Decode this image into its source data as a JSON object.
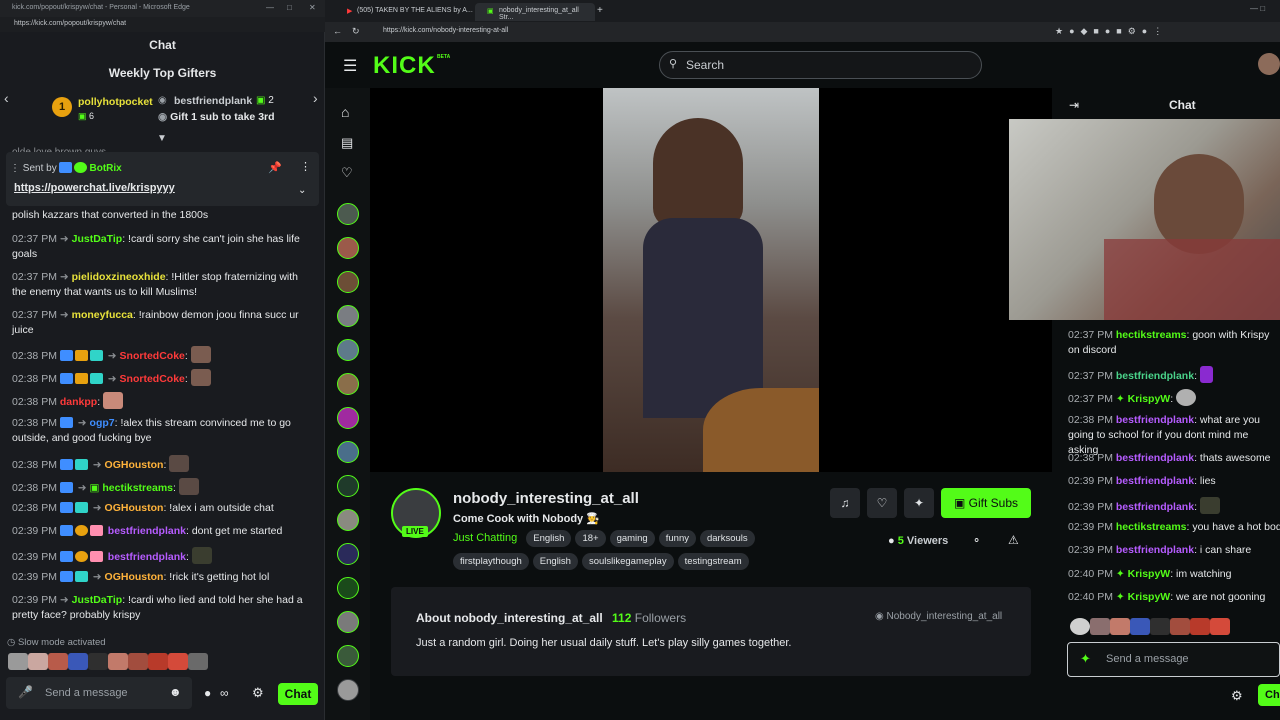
{
  "left_window": {
    "title": "kick.com/popout/krispyw/chat - Personal - Microsoft Edge",
    "url": "https://kick.com/popout/krispyw/chat",
    "chat_heading": "Chat",
    "gifters_title": "Weekly Top Gifters",
    "gifter1": {
      "rank": "1",
      "name": "pollyhotpocket",
      "count": "6"
    },
    "gifter2": {
      "name": "bestfriendplank",
      "count": "2",
      "note": "Gift 1 sub to take 3rd"
    },
    "cutoff_text": "olde love brown guys",
    "pinned": {
      "sent_by": "Sent by",
      "sender": "BotRix",
      "link": "https://powerchat.live/krispyyy"
    },
    "messages": [
      {
        "ts": "",
        "user": "",
        "text": "polish kazzars that converted in the 1800s"
      },
      {
        "ts": "02:37 PM",
        "user": "JustDaTip",
        "text": "!cardi sorry she can't join she has life goals"
      },
      {
        "ts": "02:37 PM",
        "user": "pielidoxzineoxhide",
        "text": "!Hitler stop fraternizing with the enemy that wants us to kill Muslims!"
      },
      {
        "ts": "02:37 PM",
        "user": "moneyfucca",
        "text": "!rainbow demon joou finna succ ur juice"
      },
      {
        "ts": "02:38 PM",
        "user": "SnortedCoke",
        "text": ""
      },
      {
        "ts": "02:38 PM",
        "user": "SnortedCoke",
        "text": ""
      },
      {
        "ts": "02:38 PM",
        "user": "dankpp",
        "text": ""
      },
      {
        "ts": "02:38 PM",
        "user": "ogp7",
        "text": "!alex this stream convinced me to go outside, and good fucking bye"
      },
      {
        "ts": "02:38 PM",
        "user": "OGHouston",
        "text": ""
      },
      {
        "ts": "02:38 PM",
        "user": "hectikstreams",
        "text": ""
      },
      {
        "ts": "02:38 PM",
        "user": "OGHouston",
        "text": "!alex i am outside chat"
      },
      {
        "ts": "02:39 PM",
        "user": "bestfriendplank",
        "text": "dont get me started"
      },
      {
        "ts": "02:39 PM",
        "user": "bestfriendplank",
        "text": ""
      },
      {
        "ts": "02:39 PM",
        "user": "OGHouston",
        "text": "!rick it's getting hot lol"
      },
      {
        "ts": "02:39 PM",
        "user": "JustDaTip",
        "text": "!cardi who lied and told her she had a pretty face? probably krispy"
      }
    ],
    "slow_mode": "Slow mode activated",
    "send_placeholder": "Send a message",
    "chat_button": "Chat"
  },
  "browser": {
    "tab1": "(505) TAKEN BY THE ALIENS by A...",
    "tab2": "nobody_interesting_at_all Str...",
    "url": "https://kick.com/nobody-interesting-at-all",
    "logo": "KICK",
    "logo_beta": "BETA",
    "search_placeholder": "Search"
  },
  "stream": {
    "channel": "nobody_interesting_at_all",
    "title": "Come Cook with Nobody 🧑‍🍳",
    "live_badge": "LIVE",
    "category": "Just Chatting",
    "tags_row1": [
      "English",
      "18+",
      "gaming",
      "funny",
      "darksouls"
    ],
    "tags_row2": [
      "firstplaythough",
      "English",
      "soulslikegameplay",
      "testingstream"
    ],
    "viewers_count": "5",
    "viewers_label": "Viewers",
    "gift_subs": "Gift Subs",
    "about_title": "About nobody_interesting_at_all",
    "followers_count": "112",
    "followers_label": "Followers",
    "about_link": "Nobody_interesting_at_all",
    "about_text": "Just a random girl. Doing her usual daily stuff. Let's play silly games together."
  },
  "right_chat": {
    "heading": "Chat",
    "messages": [
      {
        "ts": "02:37 PM",
        "user": "hectikstreams",
        "text": "goon with Krispy on discord"
      },
      {
        "ts": "02:37 PM",
        "user": "bestfriendplank",
        "text": ""
      },
      {
        "ts": "02:37 PM",
        "user": "KrispyW",
        "text": ""
      },
      {
        "ts": "02:38 PM",
        "user": "bestfriendplank",
        "text": "what are you going to school for if you dont mind me asking"
      },
      {
        "ts": "02:38 PM",
        "user": "bestfriendplank",
        "text": "thats awesome"
      },
      {
        "ts": "02:39 PM",
        "user": "bestfriendplank",
        "text": "lies"
      },
      {
        "ts": "02:39 PM",
        "user": "bestfriendplank",
        "text": ""
      },
      {
        "ts": "02:39 PM",
        "user": "hectikstreams",
        "text": "you have a hot body"
      },
      {
        "ts": "02:39 PM",
        "user": "bestfriendplank",
        "text": "i can share"
      },
      {
        "ts": "02:40 PM",
        "user": "KrispyW",
        "text": "im watching"
      },
      {
        "ts": "02:40 PM",
        "user": "KrispyW",
        "text": "we are not gooning"
      }
    ],
    "send_placeholder": "Send a message",
    "chat_button": "Chat"
  },
  "colors": {
    "kick_green": "#53fc18",
    "panel": "#191b1f",
    "bg": "#0b0e0f"
  }
}
